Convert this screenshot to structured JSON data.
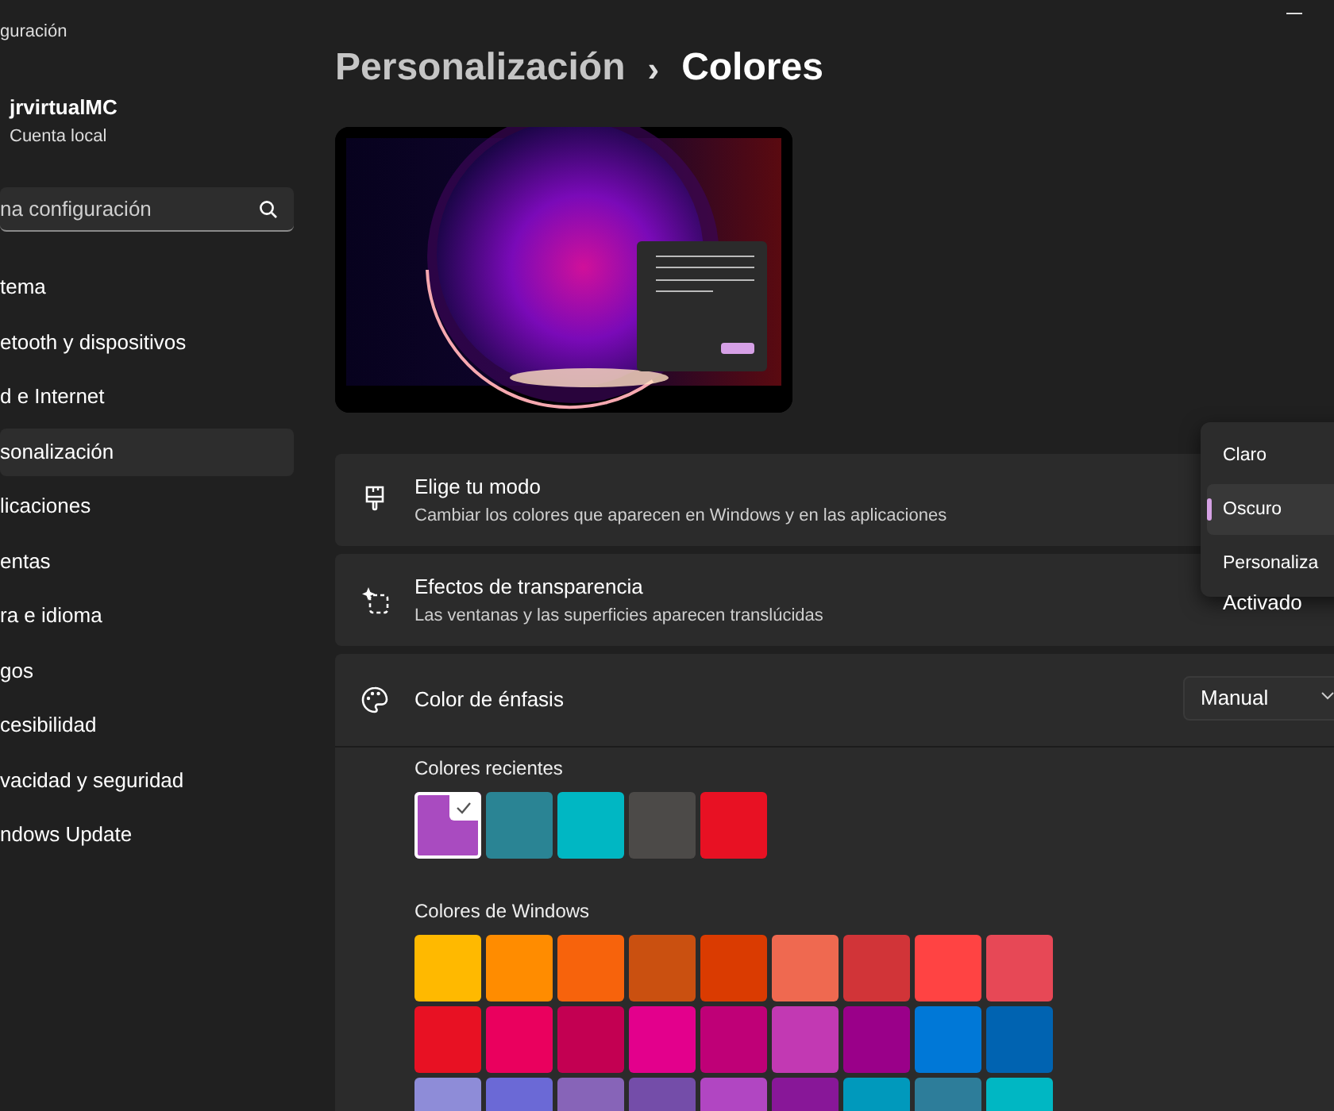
{
  "window": {
    "title": "guración"
  },
  "account": {
    "name": "jrvirtualMC",
    "type": "Cuenta local"
  },
  "search": {
    "placeholder": "na configuración"
  },
  "sidebar": {
    "items": [
      {
        "label": "tema",
        "selected": false
      },
      {
        "label": "etooth y dispositivos",
        "selected": false
      },
      {
        "label": "d e Internet",
        "selected": false
      },
      {
        "label": "sonalización",
        "selected": true
      },
      {
        "label": "licaciones",
        "selected": false
      },
      {
        "label": "entas",
        "selected": false
      },
      {
        "label": "ra e idioma",
        "selected": false
      },
      {
        "label": "gos",
        "selected": false
      },
      {
        "label": "cesibilidad",
        "selected": false
      },
      {
        "label": "vacidad y seguridad",
        "selected": false
      },
      {
        "label": "ndows Update",
        "selected": false
      }
    ]
  },
  "breadcrumb": {
    "parent": "Personalización",
    "separator": "›",
    "current": "Colores"
  },
  "settings": [
    {
      "kind": "mode",
      "title": "Elige tu modo",
      "description": "Cambiar los colores que aparecen en Windows y en las aplicaciones",
      "menu": [
        {
          "label": "Claro",
          "selected": false
        },
        {
          "label": "Oscuro",
          "selected": true
        },
        {
          "label": "Personaliza",
          "selected": false
        }
      ]
    },
    {
      "kind": "transparency",
      "title": "Efectos de transparencia",
      "description": "Las ventanas y las superficies aparecen translúcidas",
      "value": "Activado"
    },
    {
      "kind": "accent",
      "title": "Color de énfasis",
      "value": "Manual",
      "recent": {
        "title": "Colores recientes",
        "colors": [
          {
            "color": "#a94bc0",
            "selected": true
          },
          {
            "color": "#2a8494",
            "selected": false
          },
          {
            "color": "#00b7c3",
            "selected": false
          },
          {
            "color": "#4c4a48",
            "selected": false
          },
          {
            "color": "#e81123",
            "selected": false
          }
        ]
      },
      "windows": {
        "title": "Colores de Windows",
        "colors": [
          {
            "color": "#ffb900",
            "selected": false
          },
          {
            "color": "#ff8c00",
            "selected": false
          },
          {
            "color": "#f7630c",
            "selected": false
          },
          {
            "color": "#ca5010",
            "selected": false
          },
          {
            "color": "#da3b01",
            "selected": false
          },
          {
            "color": "#ef6950",
            "selected": false
          },
          {
            "color": "#d13438",
            "selected": false
          },
          {
            "color": "#ff4343",
            "selected": false
          },
          {
            "color": "#e74856",
            "selected": false
          },
          {
            "color": "#e81123",
            "selected": false
          },
          {
            "color": "#ea005e",
            "selected": false
          },
          {
            "color": "#c30052",
            "selected": false
          },
          {
            "color": "#e3008c",
            "selected": false
          },
          {
            "color": "#bf0077",
            "selected": false
          },
          {
            "color": "#c239b3",
            "selected": false
          },
          {
            "color": "#9a0089",
            "selected": false
          },
          {
            "color": "#0078d7",
            "selected": false
          },
          {
            "color": "#0063b1",
            "selected": false
          },
          {
            "color": "#8e8cd8",
            "selected": false
          },
          {
            "color": "#6b69d6",
            "selected": false
          },
          {
            "color": "#8764b8",
            "selected": false
          },
          {
            "color": "#744da9",
            "selected": false
          },
          {
            "color": "#b146c2",
            "selected": false
          },
          {
            "color": "#881798",
            "selected": false
          },
          {
            "color": "#0099bc",
            "selected": false
          },
          {
            "color": "#2d7d9a",
            "selected": false
          },
          {
            "color": "#00b7c3",
            "selected": false
          }
        ]
      }
    }
  ]
}
